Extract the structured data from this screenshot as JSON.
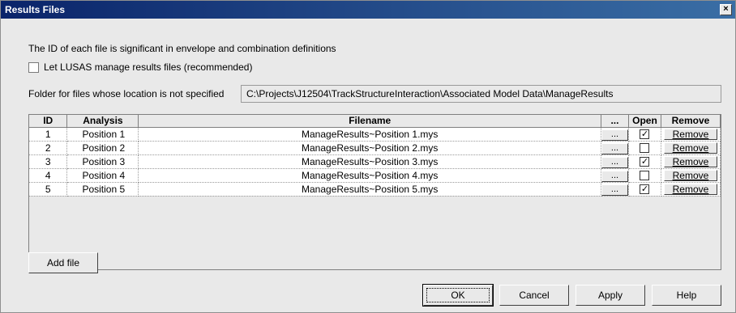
{
  "window": {
    "title": "Results Files",
    "close_glyph": "×"
  },
  "intro_text": "The ID of each file is significant in envelope and combination definitions",
  "manage_option": {
    "label": "Let LUSAS manage results files (recommended)",
    "checked": false
  },
  "folder": {
    "label": "Folder for files whose location is not specified",
    "value": "C:\\Projects\\J12504\\TrackStructureInteraction\\Associated Model Data\\ManageResults"
  },
  "table": {
    "columns": {
      "id": "ID",
      "analysis": "Analysis",
      "filename": "Filename",
      "browse": "...",
      "open": "Open",
      "remove": "Remove"
    },
    "rows": [
      {
        "id": "1",
        "analysis": "Position 1",
        "filename": "ManageResults~Position 1.mys",
        "browse": "...",
        "open": "✓",
        "remove": "Remove"
      },
      {
        "id": "2",
        "analysis": "Position 2",
        "filename": "ManageResults~Position 2.mys",
        "browse": "...",
        "open": "",
        "remove": "Remove"
      },
      {
        "id": "3",
        "analysis": "Position 3",
        "filename": "ManageResults~Position 3.mys",
        "browse": "...",
        "open": "✓",
        "remove": "Remove"
      },
      {
        "id": "4",
        "analysis": "Position 4",
        "filename": "ManageResults~Position 4.mys",
        "browse": "...",
        "open": "",
        "remove": "Remove"
      },
      {
        "id": "5",
        "analysis": "Position 5",
        "filename": "ManageResults~Position 5.mys",
        "browse": "...",
        "open": "✓",
        "remove": "Remove"
      }
    ]
  },
  "buttons": {
    "add_file": "Add file",
    "ok": "OK",
    "cancel": "Cancel",
    "apply": "Apply",
    "help": "Help"
  }
}
